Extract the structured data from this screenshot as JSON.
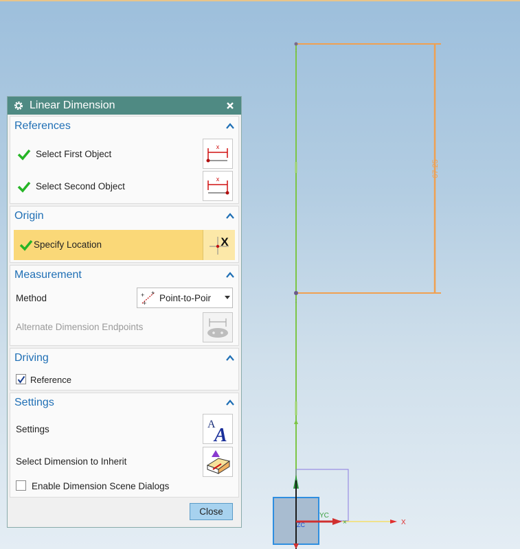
{
  "dialog": {
    "title": "Linear Dimension",
    "close_label": "Close"
  },
  "sections": {
    "references": {
      "title": "References",
      "first_object_label": "Select First Object",
      "second_object_label": "Select Second Object"
    },
    "origin": {
      "title": "Origin",
      "location_label": "Specify Location"
    },
    "measurement": {
      "title": "Measurement",
      "method_label": "Method",
      "method_value": "Point-to-Poir",
      "alternate_label": "Alternate Dimension Endpoints"
    },
    "driving": {
      "title": "Driving",
      "reference_label": "Reference",
      "reference_checked": true
    },
    "settings": {
      "title": "Settings",
      "settings_label": "Settings",
      "inherit_label": "Select Dimension to Inherit",
      "enable_scene_label": "Enable Dimension Scene Dialogs",
      "enable_scene_checked": false
    }
  },
  "viewport": {
    "dimension_value": "67.25",
    "axis_x_label": "X",
    "axis_yc_label": "YC",
    "axis_zc_label": "ZC"
  },
  "colors": {
    "title_bar": "#4f8a83",
    "section_title": "#1f6fb5",
    "highlight": "#fad878",
    "sketch_line": "#7cc545",
    "dimension_line": "#f0a050",
    "close_button": "#a7d2ef"
  }
}
